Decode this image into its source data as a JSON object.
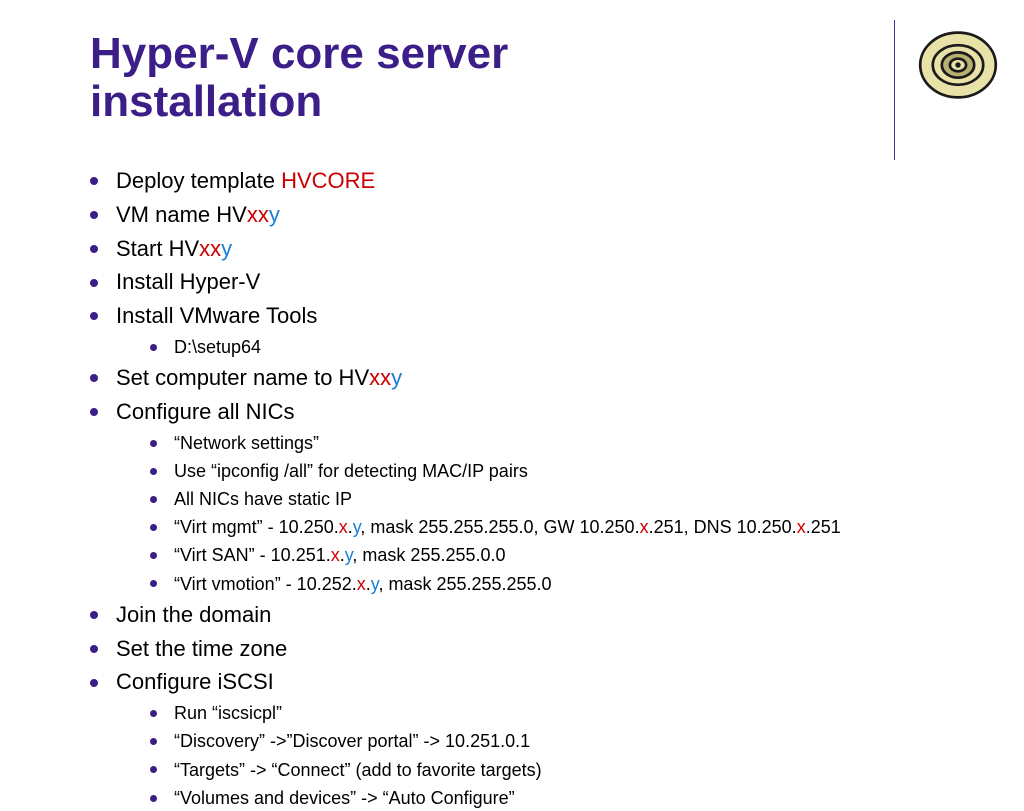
{
  "title": "Hyper-V core server installation",
  "bullets": {
    "b1": {
      "t1": "Deploy template ",
      "t2": "HVCORE"
    },
    "b2": {
      "t1": "VM name HV",
      "t2": "xx",
      "t3": "y"
    },
    "b3": {
      "t1": "Start HV",
      "t2": "xx",
      "t3": "y"
    },
    "b4": "Install Hyper-V",
    "b5": "Install VMware Tools",
    "b5_sub": {
      "s1": "D:\\setup64"
    },
    "b6": {
      "t1": "Set computer name to HV",
      "t2": "xx",
      "t3": "y"
    },
    "b7": "Configure all NICs",
    "b7_sub": {
      "s1": "“Network settings”",
      "s2": "Use “ipconfig /all” for detecting MAC/IP pairs",
      "s3": "All NICs have static IP",
      "s4": {
        "t1": "“Virt mgmt” - 10.250.",
        "t2": "x",
        "t3": ".",
        "t4": "y",
        "t5": ", mask 255.255.255.0, GW 10.250.",
        "t6": "x",
        "t7": ".251, DNS 10.250.",
        "t8": "x",
        "t9": ".251"
      },
      "s5": {
        "t1": "“Virt SAN” - 10.251.",
        "t2": "x",
        "t3": ".",
        "t4": "y",
        "t5": ", mask 255.255.0.0"
      },
      "s6": {
        "t1": "“Virt vmotion” - 10.252.",
        "t2": "x",
        "t3": ".",
        "t4": "y",
        "t5": ", mask 255.255.255.0"
      }
    },
    "b8": "Join the domain",
    "b9": "Set the time zone",
    "b10": "Configure iSCSI",
    "b10_sub": {
      "s1": "Run “iscsicpl”",
      "s2": "“Discovery” ->”Discover portal” -> 10.251.0.1",
      "s3": "“Targets” -> “Connect” (add to favorite targets)",
      "s4": "“Volumes and devices” -> “Auto Configure”"
    }
  }
}
